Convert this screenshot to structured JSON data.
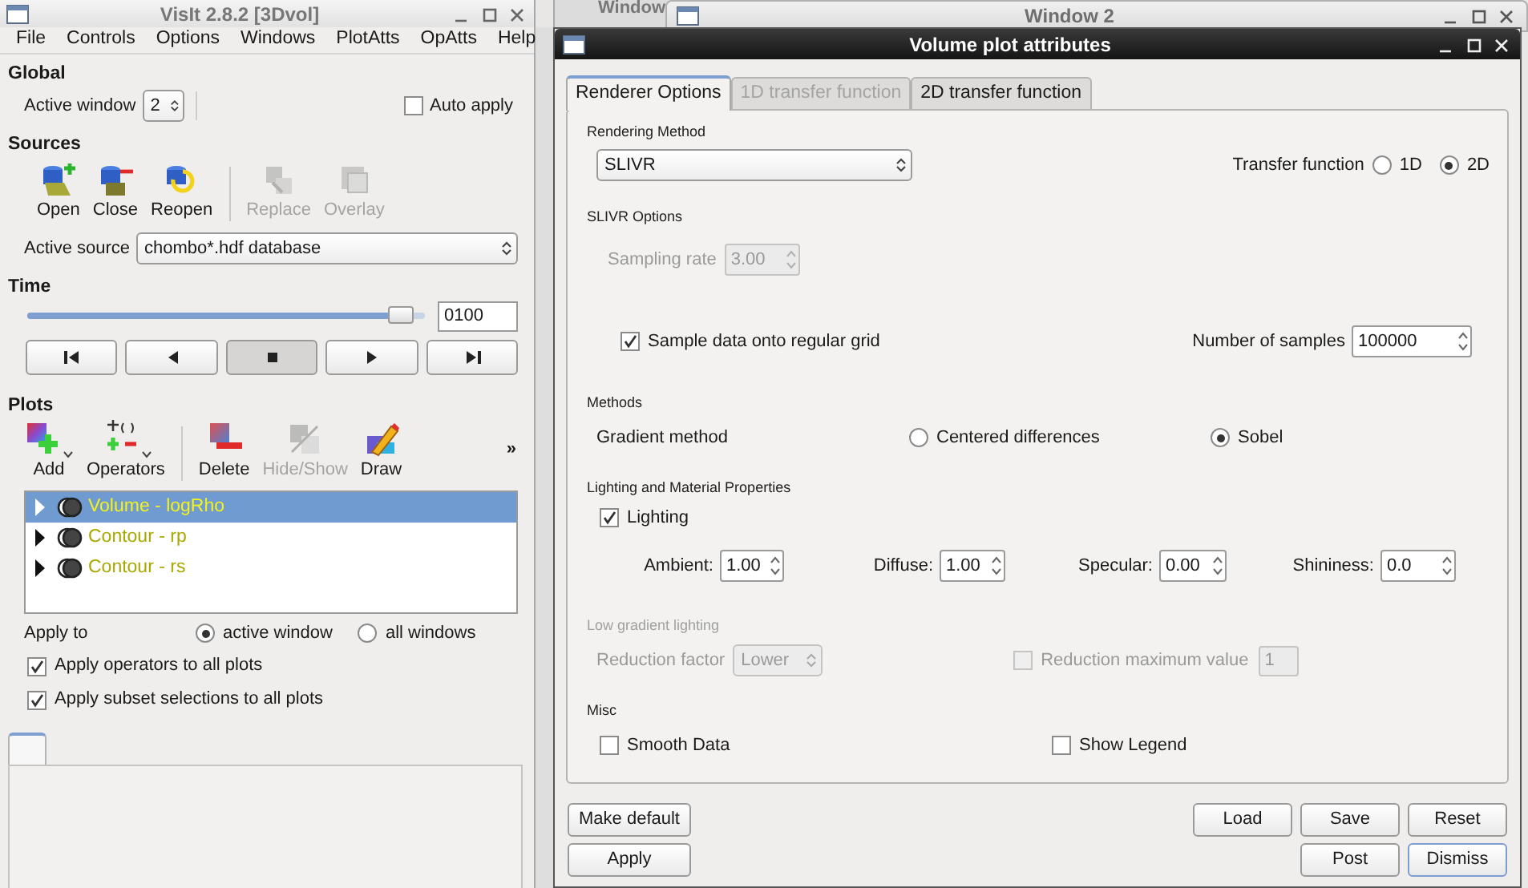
{
  "background_windows": [
    {
      "title": "Window"
    },
    {
      "title": "Window 2"
    }
  ],
  "main_window": {
    "title": "VisIt 2.8.2 [3Dvol]",
    "menu": [
      "File",
      "Controls",
      "Options",
      "Windows",
      "PlotAtts",
      "OpAtts",
      "Help"
    ],
    "global": {
      "heading": "Global",
      "active_window_label": "Active window",
      "active_window_value": "2",
      "auto_apply": {
        "label": "Auto apply",
        "checked": false
      }
    },
    "sources": {
      "heading": "Sources",
      "tools": [
        {
          "kind": "open",
          "label": "Open",
          "disabled": false
        },
        {
          "kind": "close",
          "label": "Close",
          "disabled": false
        },
        {
          "kind": "reopen",
          "label": "Reopen",
          "disabled": false
        },
        {
          "kind": "separator"
        },
        {
          "kind": "replace",
          "label": "Replace",
          "disabled": true
        },
        {
          "kind": "overlay",
          "label": "Overlay",
          "disabled": true
        }
      ],
      "active_source_label": "Active source",
      "active_source_value": "chombo*.hdf database"
    },
    "time": {
      "heading": "Time",
      "level": 0.97,
      "value": "0100",
      "controls": [
        {
          "kind": "step-back",
          "selected": false
        },
        {
          "kind": "play-back",
          "selected": false
        },
        {
          "kind": "stop",
          "selected": true
        },
        {
          "kind": "play",
          "selected": false
        },
        {
          "kind": "step-forward",
          "selected": false
        }
      ]
    },
    "plots": {
      "heading": "Plots",
      "tools": [
        {
          "kind": "add",
          "label": "Add",
          "disabled": false,
          "menu": true
        },
        {
          "kind": "operators",
          "label": "Operators",
          "disabled": false,
          "menu": true
        },
        {
          "kind": "separator"
        },
        {
          "kind": "delete",
          "label": "Delete",
          "disabled": false,
          "menu": false
        },
        {
          "kind": "hide-show",
          "label": "Hide/Show",
          "disabled": true,
          "menu": false
        },
        {
          "kind": "draw",
          "label": "Draw",
          "disabled": false,
          "menu": false
        }
      ],
      "overflow": "»",
      "list": [
        {
          "label": "Volume - logRho",
          "selected": true
        },
        {
          "label": "Contour - rp",
          "selected": false
        },
        {
          "label": "Contour - rs",
          "selected": false
        }
      ],
      "apply_to": {
        "label": "Apply to",
        "options": [
          {
            "label": "active window",
            "selected": true
          },
          {
            "label": "all windows",
            "selected": false
          }
        ]
      },
      "options": [
        {
          "label": "Apply operators to all plots",
          "checked": true
        },
        {
          "label": "Apply subset selections to all plots",
          "checked": true
        }
      ]
    }
  },
  "dialog": {
    "title": "Volume plot attributes",
    "tabs": [
      {
        "label": "Renderer Options",
        "selected": true,
        "disabled": false
      },
      {
        "label": "1D transfer function",
        "selected": false,
        "disabled": true
      },
      {
        "label": "2D transfer function",
        "selected": false,
        "disabled": false
      }
    ],
    "rendering_method": {
      "heading": "Rendering Method",
      "value": "SLIVR",
      "transfer_function": {
        "label": "Transfer function",
        "options": [
          {
            "label": "1D",
            "selected": false
          },
          {
            "label": "2D",
            "selected": true
          }
        ]
      }
    },
    "slivr_options": {
      "heading": "SLIVR Options",
      "sampling_rate": {
        "label": "Sampling rate",
        "value": "3.00",
        "disabled": true
      },
      "sample_grid": {
        "label": "Sample data onto regular grid",
        "checked": true
      },
      "number_of_samples": {
        "label": "Number of samples",
        "value": "100000"
      }
    },
    "methods": {
      "heading": "Methods",
      "label": "Gradient method",
      "options": [
        {
          "label": "Centered differences",
          "selected": false
        },
        {
          "label": "Sobel",
          "selected": true
        }
      ]
    },
    "lighting": {
      "heading": "Lighting and Material Properties",
      "lighting": {
        "label": "Lighting",
        "checked": true
      },
      "fields": [
        {
          "label": "Ambient:",
          "value": "1.00"
        },
        {
          "label": "Diffuse:",
          "value": "1.00"
        },
        {
          "label": "Specular:",
          "value": "0.00"
        },
        {
          "label": "Shininess:",
          "value": "0.0"
        }
      ]
    },
    "low_gradient": {
      "heading": "Low gradient lighting",
      "disabled": true,
      "reduction_factor": {
        "label": "Reduction factor",
        "value": "Lower"
      },
      "reduction_max": {
        "label": "Reduction maximum value",
        "checked": false,
        "value": "1"
      }
    },
    "misc": {
      "heading": "Misc",
      "options": [
        {
          "label": "Smooth Data",
          "checked": false
        },
        {
          "label": "Show Legend",
          "checked": false
        }
      ]
    },
    "buttons_left": [
      {
        "label": "Make default",
        "focused": false
      },
      {
        "label": "Apply",
        "focused": false
      }
    ],
    "buttons_right": [
      [
        {
          "label": "Load",
          "focused": false
        },
        {
          "label": "Save",
          "focused": false
        },
        {
          "label": "Reset",
          "focused": false
        }
      ],
      [
        {
          "label": "Post",
          "focused": false
        },
        {
          "label": "Dismiss",
          "focused": true
        }
      ]
    ]
  }
}
